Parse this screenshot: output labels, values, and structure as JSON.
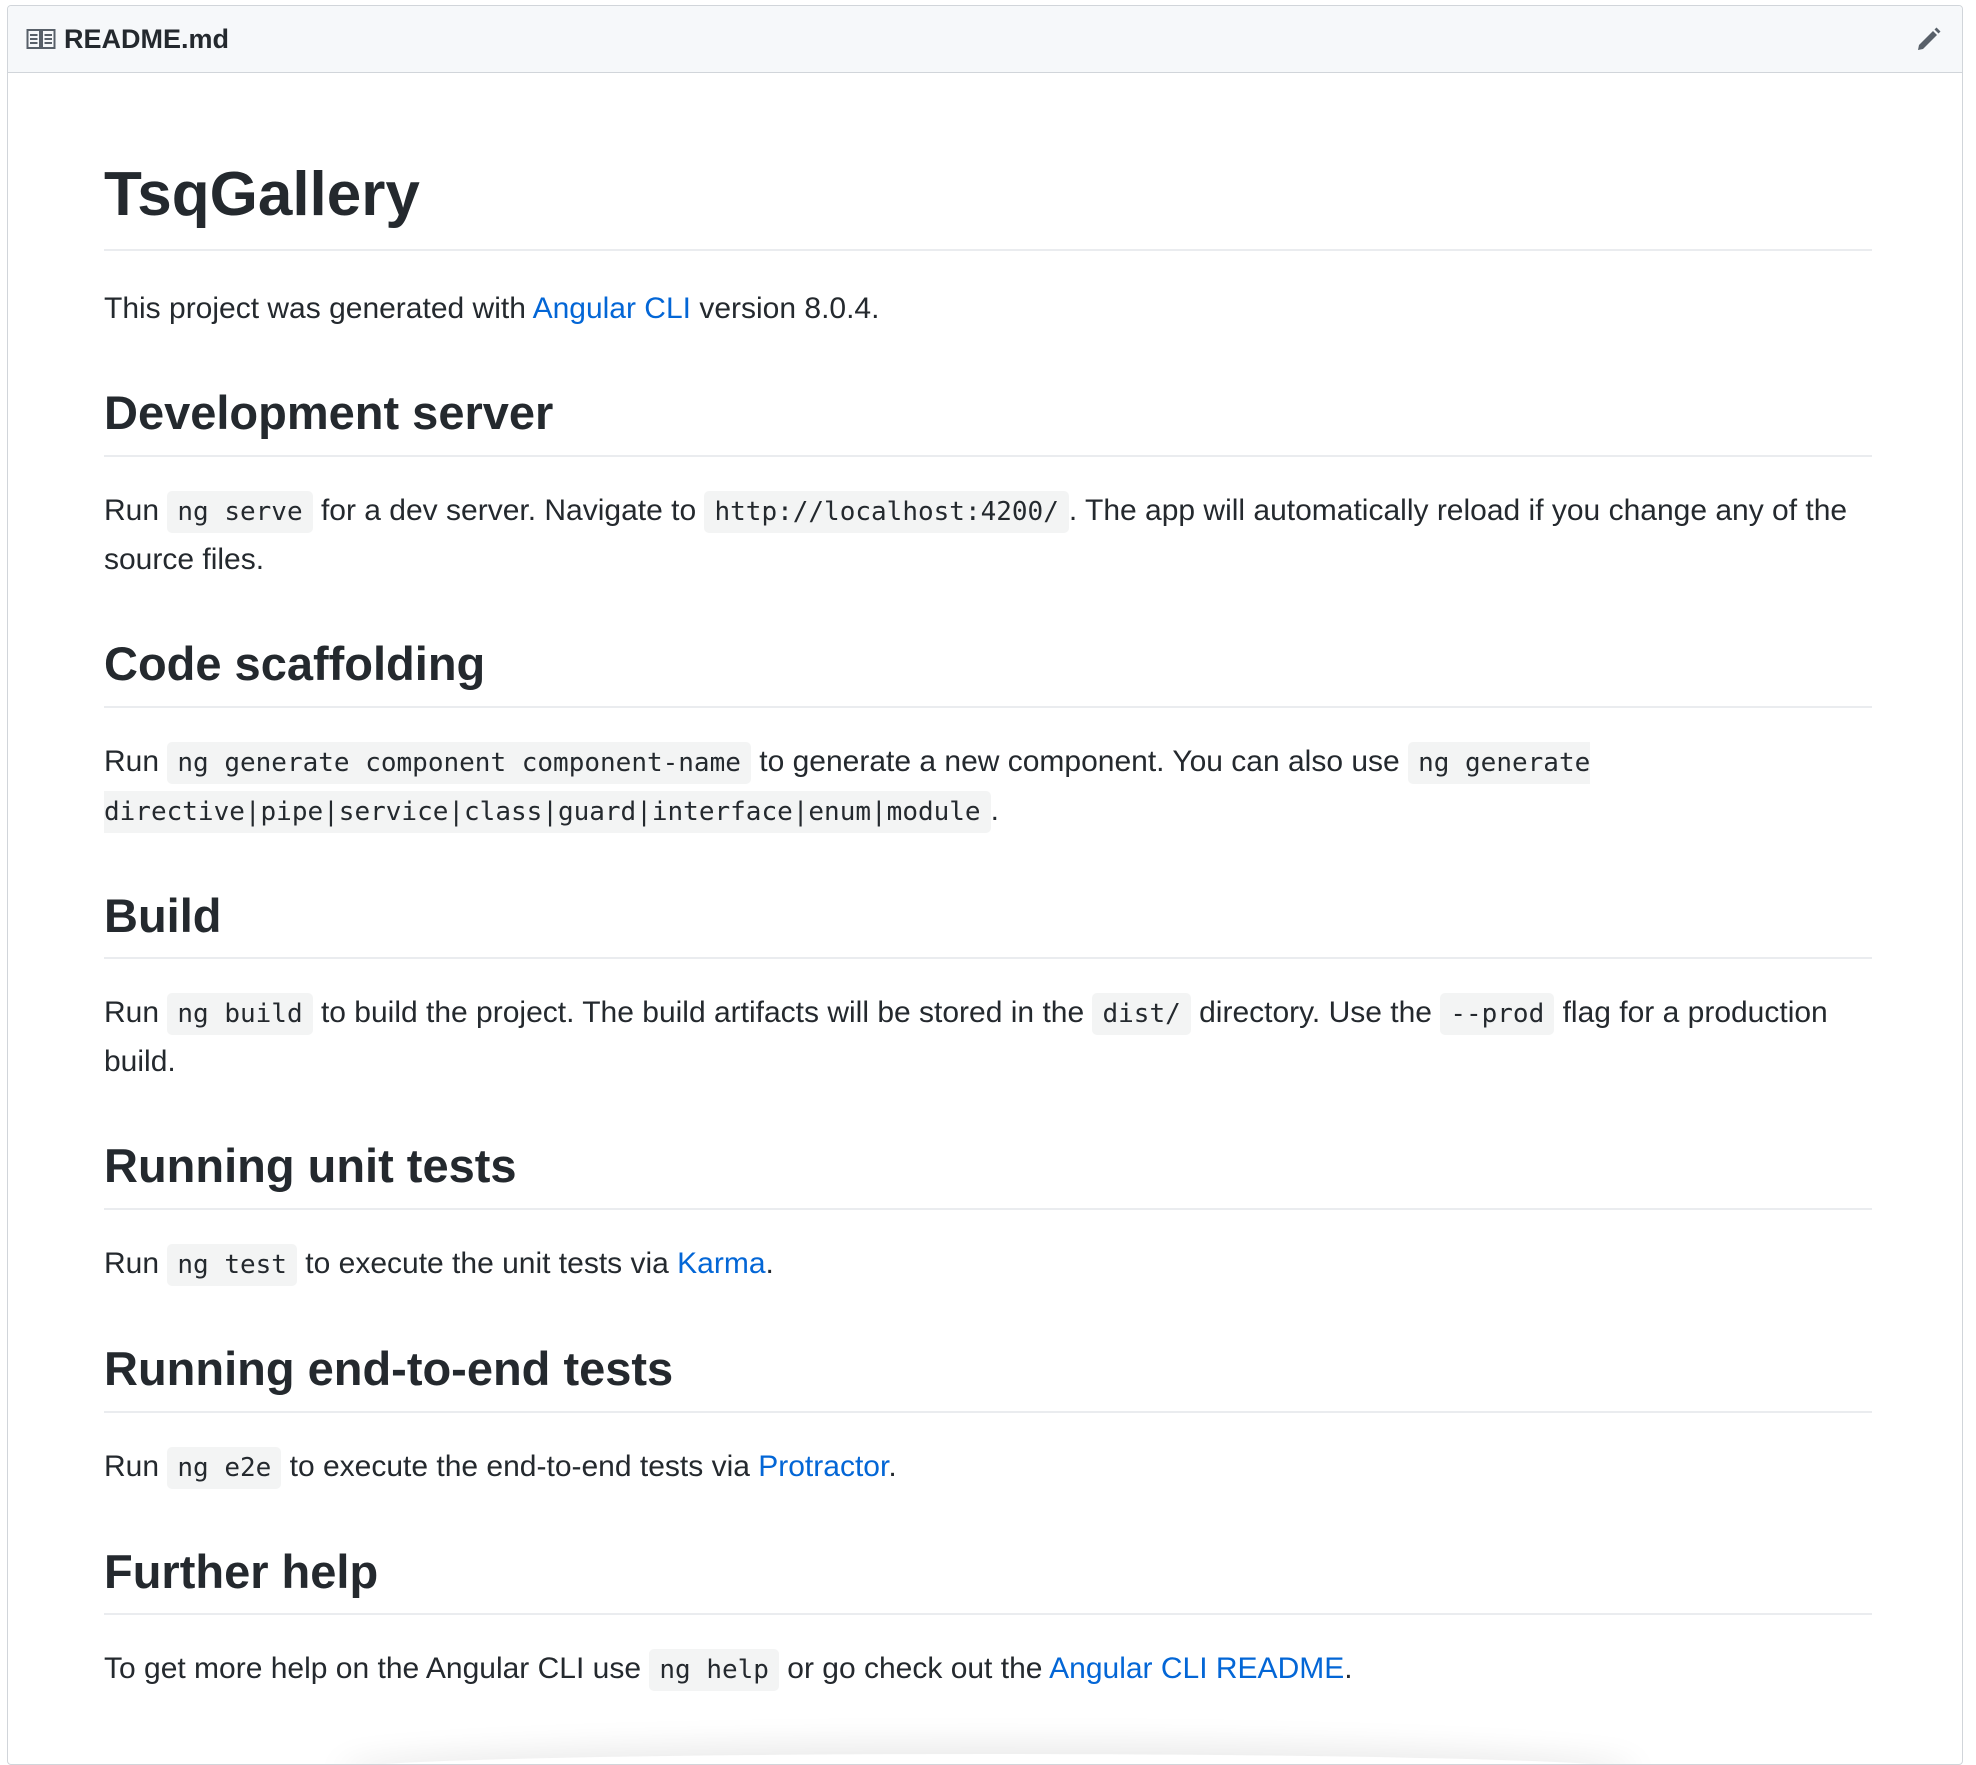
{
  "header": {
    "file_name": "README.md",
    "book_icon": "book-icon",
    "edit_icon": "pencil-icon"
  },
  "doc": {
    "title": "TsqGallery",
    "intro": {
      "before": "This project was generated with ",
      "link": "Angular CLI",
      "after": " version 8.0.4."
    },
    "dev_server": {
      "heading": "Development server",
      "t1": "Run ",
      "c1": "ng serve",
      "t2": " for a dev server. Navigate to ",
      "c2": "http://localhost:4200/",
      "t3": ". The app will automatically reload if you change any of the source files."
    },
    "scaffolding": {
      "heading": "Code scaffolding",
      "t1": "Run ",
      "c1": "ng generate component component-name",
      "t2": " to generate a new component. You can also use ",
      "c2": "ng generate directive|pipe|service|class|guard|interface|enum|module",
      "t3": "."
    },
    "build": {
      "heading": "Build",
      "t1": "Run ",
      "c1": "ng build",
      "t2": " to build the project. The build artifacts will be stored in the ",
      "c2": "dist/",
      "t3": " directory. Use the ",
      "c3": "--prod",
      "t4": " flag for a production build."
    },
    "unit_tests": {
      "heading": "Running unit tests",
      "t1": "Run ",
      "c1": "ng test",
      "t2": " to execute the unit tests via ",
      "link": "Karma",
      "t3": "."
    },
    "e2e_tests": {
      "heading": "Running end-to-end tests",
      "t1": "Run ",
      "c1": "ng e2e",
      "t2": " to execute the end-to-end tests via ",
      "link": "Protractor",
      "t3": "."
    },
    "help": {
      "heading": "Further help",
      "t1": "To get more help on the Angular CLI use ",
      "c1": "ng help",
      "t2": " or go check out the ",
      "link": "Angular CLI README",
      "t3": "."
    }
  },
  "colors": {
    "link": "#0366d6",
    "text": "#24292e",
    "header_bg": "#f6f8fa",
    "border": "#d1d5da"
  }
}
